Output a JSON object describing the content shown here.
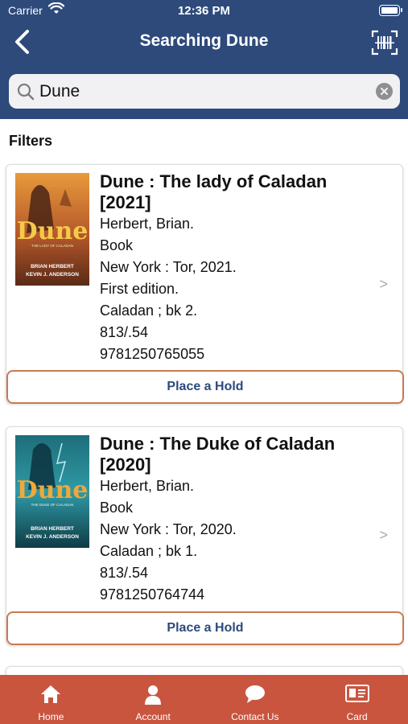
{
  "status_bar": {
    "carrier": "Carrier",
    "time": "12:36 PM"
  },
  "nav": {
    "title": "Searching Dune",
    "back_icon": "chevron-left-icon",
    "scan_icon": "barcode-scan-icon"
  },
  "search": {
    "value": "Dune",
    "placeholder": ""
  },
  "filters_label": "Filters",
  "results": [
    {
      "title": "Dune : The lady of Caladan [2021]",
      "author": "Herbert, Brian.",
      "format": "Book",
      "publication": "New York : Tor, 2021.",
      "edition": "First edition.",
      "series": "Caladan ; bk 2.",
      "call_number": "813/.54",
      "isbn": "9781250765055",
      "hold_label": "Place a Hold",
      "cover": {
        "word": "Dune",
        "subtitle": "THE LADY OF CALADAN",
        "authors_line1": "BRIAN HERBERT",
        "authors_line2": "KEVIN J. ANDERSON"
      }
    },
    {
      "title": "Dune : The Duke of Caladan [2020]",
      "author": "Herbert, Brian.",
      "format": "Book",
      "publication": "New York : Tor, 2020.",
      "series": "Caladan ; bk 1.",
      "call_number": "813/.54",
      "isbn": "9781250764744",
      "hold_label": "Place a Hold",
      "cover": {
        "word": "Dune",
        "subtitle": "THE DUKE OF CALADAN",
        "authors_line1": "BRIAN HERBERT",
        "authors_line2": "KEVIN J. ANDERSON"
      }
    }
  ],
  "tabs": [
    {
      "label": "Home",
      "icon": "home-icon"
    },
    {
      "label": "Account",
      "icon": "person-icon"
    },
    {
      "label": "Contact Us",
      "icon": "chat-bubble-icon"
    },
    {
      "label": "Card",
      "icon": "id-card-icon"
    }
  ],
  "colors": {
    "header": "#2d4a7b",
    "tabbar": "#c9553f",
    "hold_border": "#c77b50",
    "hold_text": "#2d4a7b"
  }
}
